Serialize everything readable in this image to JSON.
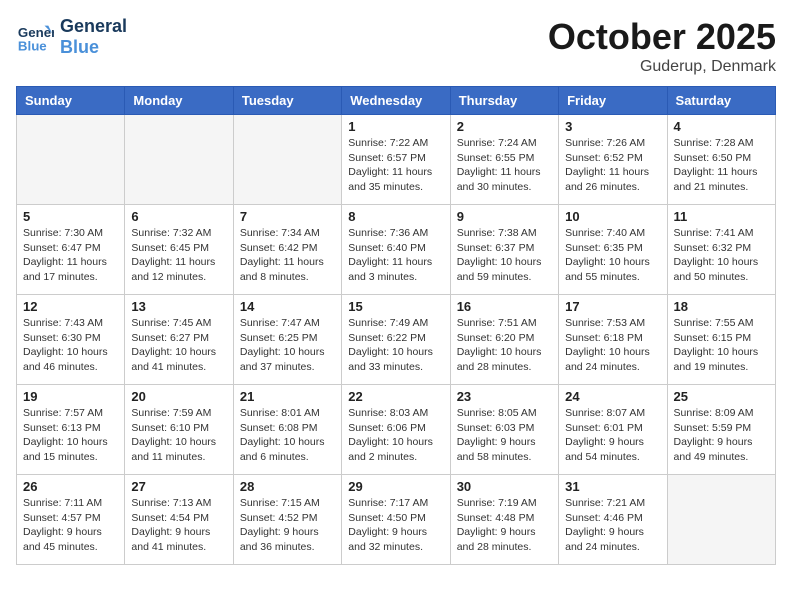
{
  "header": {
    "logo_line1": "General",
    "logo_line2": "Blue",
    "month_title": "October 2025",
    "location": "Guderup, Denmark"
  },
  "weekdays": [
    "Sunday",
    "Monday",
    "Tuesday",
    "Wednesday",
    "Thursday",
    "Friday",
    "Saturday"
  ],
  "weeks": [
    [
      {
        "day": "",
        "detail": ""
      },
      {
        "day": "",
        "detail": ""
      },
      {
        "day": "",
        "detail": ""
      },
      {
        "day": "1",
        "detail": "Sunrise: 7:22 AM\nSunset: 6:57 PM\nDaylight: 11 hours\nand 35 minutes."
      },
      {
        "day": "2",
        "detail": "Sunrise: 7:24 AM\nSunset: 6:55 PM\nDaylight: 11 hours\nand 30 minutes."
      },
      {
        "day": "3",
        "detail": "Sunrise: 7:26 AM\nSunset: 6:52 PM\nDaylight: 11 hours\nand 26 minutes."
      },
      {
        "day": "4",
        "detail": "Sunrise: 7:28 AM\nSunset: 6:50 PM\nDaylight: 11 hours\nand 21 minutes."
      }
    ],
    [
      {
        "day": "5",
        "detail": "Sunrise: 7:30 AM\nSunset: 6:47 PM\nDaylight: 11 hours\nand 17 minutes."
      },
      {
        "day": "6",
        "detail": "Sunrise: 7:32 AM\nSunset: 6:45 PM\nDaylight: 11 hours\nand 12 minutes."
      },
      {
        "day": "7",
        "detail": "Sunrise: 7:34 AM\nSunset: 6:42 PM\nDaylight: 11 hours\nand 8 minutes."
      },
      {
        "day": "8",
        "detail": "Sunrise: 7:36 AM\nSunset: 6:40 PM\nDaylight: 11 hours\nand 3 minutes."
      },
      {
        "day": "9",
        "detail": "Sunrise: 7:38 AM\nSunset: 6:37 PM\nDaylight: 10 hours\nand 59 minutes."
      },
      {
        "day": "10",
        "detail": "Sunrise: 7:40 AM\nSunset: 6:35 PM\nDaylight: 10 hours\nand 55 minutes."
      },
      {
        "day": "11",
        "detail": "Sunrise: 7:41 AM\nSunset: 6:32 PM\nDaylight: 10 hours\nand 50 minutes."
      }
    ],
    [
      {
        "day": "12",
        "detail": "Sunrise: 7:43 AM\nSunset: 6:30 PM\nDaylight: 10 hours\nand 46 minutes."
      },
      {
        "day": "13",
        "detail": "Sunrise: 7:45 AM\nSunset: 6:27 PM\nDaylight: 10 hours\nand 41 minutes."
      },
      {
        "day": "14",
        "detail": "Sunrise: 7:47 AM\nSunset: 6:25 PM\nDaylight: 10 hours\nand 37 minutes."
      },
      {
        "day": "15",
        "detail": "Sunrise: 7:49 AM\nSunset: 6:22 PM\nDaylight: 10 hours\nand 33 minutes."
      },
      {
        "day": "16",
        "detail": "Sunrise: 7:51 AM\nSunset: 6:20 PM\nDaylight: 10 hours\nand 28 minutes."
      },
      {
        "day": "17",
        "detail": "Sunrise: 7:53 AM\nSunset: 6:18 PM\nDaylight: 10 hours\nand 24 minutes."
      },
      {
        "day": "18",
        "detail": "Sunrise: 7:55 AM\nSunset: 6:15 PM\nDaylight: 10 hours\nand 19 minutes."
      }
    ],
    [
      {
        "day": "19",
        "detail": "Sunrise: 7:57 AM\nSunset: 6:13 PM\nDaylight: 10 hours\nand 15 minutes."
      },
      {
        "day": "20",
        "detail": "Sunrise: 7:59 AM\nSunset: 6:10 PM\nDaylight: 10 hours\nand 11 minutes."
      },
      {
        "day": "21",
        "detail": "Sunrise: 8:01 AM\nSunset: 6:08 PM\nDaylight: 10 hours\nand 6 minutes."
      },
      {
        "day": "22",
        "detail": "Sunrise: 8:03 AM\nSunset: 6:06 PM\nDaylight: 10 hours\nand 2 minutes."
      },
      {
        "day": "23",
        "detail": "Sunrise: 8:05 AM\nSunset: 6:03 PM\nDaylight: 9 hours\nand 58 minutes."
      },
      {
        "day": "24",
        "detail": "Sunrise: 8:07 AM\nSunset: 6:01 PM\nDaylight: 9 hours\nand 54 minutes."
      },
      {
        "day": "25",
        "detail": "Sunrise: 8:09 AM\nSunset: 5:59 PM\nDaylight: 9 hours\nand 49 minutes."
      }
    ],
    [
      {
        "day": "26",
        "detail": "Sunrise: 7:11 AM\nSunset: 4:57 PM\nDaylight: 9 hours\nand 45 minutes."
      },
      {
        "day": "27",
        "detail": "Sunrise: 7:13 AM\nSunset: 4:54 PM\nDaylight: 9 hours\nand 41 minutes."
      },
      {
        "day": "28",
        "detail": "Sunrise: 7:15 AM\nSunset: 4:52 PM\nDaylight: 9 hours\nand 36 minutes."
      },
      {
        "day": "29",
        "detail": "Sunrise: 7:17 AM\nSunset: 4:50 PM\nDaylight: 9 hours\nand 32 minutes."
      },
      {
        "day": "30",
        "detail": "Sunrise: 7:19 AM\nSunset: 4:48 PM\nDaylight: 9 hours\nand 28 minutes."
      },
      {
        "day": "31",
        "detail": "Sunrise: 7:21 AM\nSunset: 4:46 PM\nDaylight: 9 hours\nand 24 minutes."
      },
      {
        "day": "",
        "detail": ""
      }
    ]
  ]
}
